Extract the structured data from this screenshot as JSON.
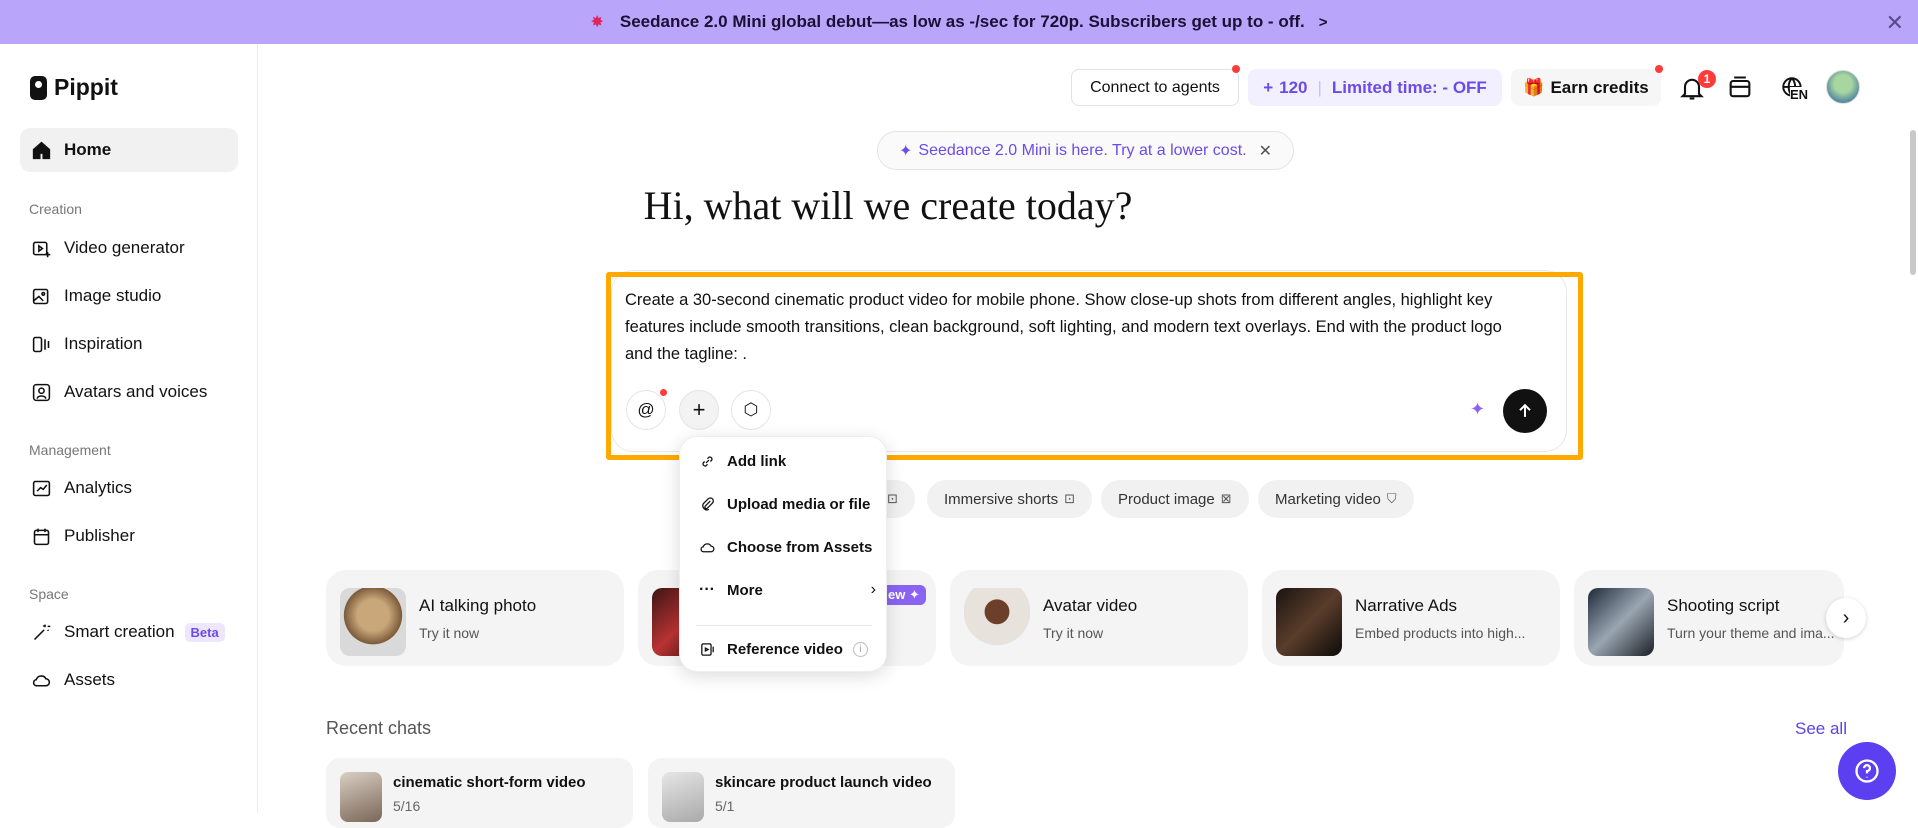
{
  "banner": {
    "text": "Seedance 2.0 Mini global debut—as low as -/sec for 720p. Subscribers get up to - off.",
    "chevron": ">"
  },
  "app": {
    "name": "Pippit"
  },
  "sidebar": {
    "home": "Home",
    "sections": [
      {
        "label": "Creation"
      },
      {
        "label": "Management"
      },
      {
        "label": "Space"
      }
    ],
    "items": [
      {
        "label": "Video generator",
        "icon": "video-plus-icon"
      },
      {
        "label": "Image studio",
        "icon": "image-plus-icon"
      },
      {
        "label": "Inspiration",
        "icon": "inspiration-icon"
      },
      {
        "label": "Avatars and voices",
        "icon": "avatar-icon"
      },
      {
        "label": "Analytics",
        "icon": "chart-icon"
      },
      {
        "label": "Publisher",
        "icon": "calendar-icon"
      },
      {
        "label": "Smart creation",
        "icon": "magic-wand-icon",
        "badge": "Beta"
      },
      {
        "label": "Assets",
        "icon": "cloud-icon"
      }
    ]
  },
  "header": {
    "connect_agents": "Connect to agents",
    "credits_count": "120",
    "credits_promo": "Limited time: - OFF",
    "earn_credits": "Earn credits",
    "notification_count": "1",
    "language": "EN"
  },
  "hero": {
    "promo_pill": "Seedance 2.0 Mini is here. Try at a lower cost.",
    "headline": "Hi, what will we create today?"
  },
  "composer": {
    "prompt": "Create a 30-second cinematic product video for mobile phone. Show close-up shots from different angles, highlight key features include smooth transitions, clean background, soft lighting, and modern text overlays. End with the product logo and the tagline: ."
  },
  "attach_menu": {
    "items": [
      {
        "label": "Add link",
        "icon": "link-icon"
      },
      {
        "label": "Upload media or file",
        "icon": "paperclip-icon"
      },
      {
        "label": "Choose from Assets",
        "icon": "cloud-icon"
      },
      {
        "label": "More",
        "icon": "more-dots-icon"
      },
      {
        "label": "Reference video",
        "icon": "reference-video-icon"
      }
    ]
  },
  "chips": [
    {
      "label": "Immersive shorts"
    },
    {
      "label": "Product image"
    },
    {
      "label": "Marketing video"
    }
  ],
  "feature_cards": [
    {
      "title": "AI talking photo",
      "subtitle": "Try it now"
    },
    {
      "title": "Avatar video",
      "subtitle": "Try it now"
    },
    {
      "title": "Narrative Ads",
      "subtitle": "Embed products into high..."
    },
    {
      "title": "Shooting script",
      "subtitle": "Turn your theme and ima..."
    }
  ],
  "new_badge": "ew ✦",
  "recent": {
    "title": "Recent chats",
    "see_all": "See all",
    "chats": [
      {
        "title": "cinematic short-form video",
        "count": "5/16"
      },
      {
        "title": "skincare product launch video",
        "count": "5/1"
      }
    ]
  }
}
